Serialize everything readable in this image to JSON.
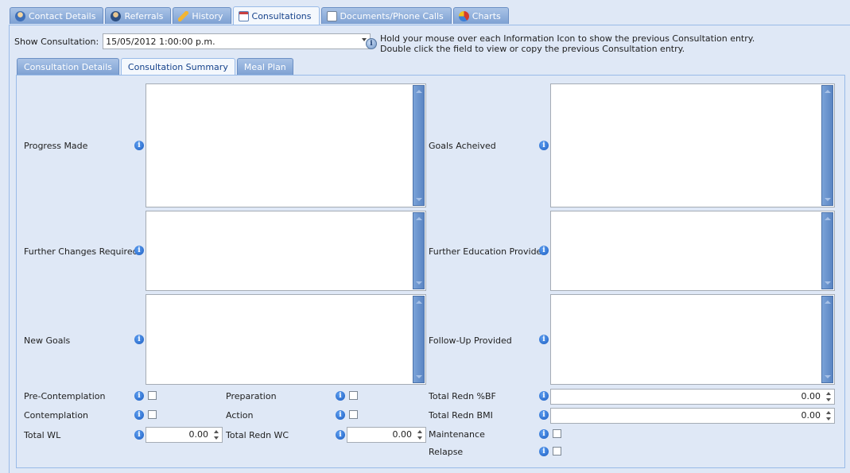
{
  "tabs": [
    {
      "label": "Contact Details",
      "icon": "contact-icon"
    },
    {
      "label": "Referrals",
      "icon": "referrals-icon"
    },
    {
      "label": "History",
      "icon": "history-icon"
    },
    {
      "label": "Consultations",
      "icon": "consultations-icon"
    },
    {
      "label": "Documents/Phone Calls",
      "icon": "documents-icon"
    },
    {
      "label": "Charts",
      "icon": "charts-icon"
    }
  ],
  "active_tab": "Consultations",
  "show_consultation": {
    "label": "Show Consultation:",
    "value": "15/05/2012 1:00:00 p.m."
  },
  "hint": {
    "line1": "Hold your mouse over each Information Icon to show the previous Consultation entry.",
    "line2": "Double click the field to view or copy the previous Consultation entry."
  },
  "sub_tabs": [
    {
      "label": "Consultation Details"
    },
    {
      "label": "Consultation Summary"
    },
    {
      "label": "Meal Plan"
    }
  ],
  "active_sub_tab": "Consultation Summary",
  "memo_fields": {
    "progress_made": "Progress Made",
    "goals_achieved": "Goals Acheived",
    "further_changes": "Further Changes Required",
    "further_education": "Further Education Provided",
    "new_goals": "New Goals",
    "follow_up": "Follow-Up Provided"
  },
  "checkboxes": {
    "pre_contemplation": {
      "label": "Pre-Contemplation",
      "checked": false
    },
    "contemplation": {
      "label": "Contemplation",
      "checked": false
    },
    "preparation": {
      "label": "Preparation",
      "checked": false
    },
    "action": {
      "label": "Action",
      "checked": false
    },
    "maintenance": {
      "label": "Maintenance",
      "checked": false
    },
    "relapse": {
      "label": "Relapse",
      "checked": false
    }
  },
  "numeric_fields": {
    "total_wl": {
      "label": "Total WL",
      "value": "0.00"
    },
    "total_redn_wc": {
      "label": "Total Redn WC",
      "value": "0.00"
    },
    "total_redn_bf": {
      "label": "Total Redn %BF",
      "value": "0.00"
    },
    "total_redn_bmi": {
      "label": "Total Redn BMI",
      "value": "0.00"
    }
  },
  "info_glyph": "i",
  "colors": {
    "background": "#dfe8f6",
    "tab_inactive": "#7ea1d3",
    "tab_active_text": "#15428b",
    "scrollbar": "#5a85c3",
    "info_icon": "#1a5cc0"
  }
}
